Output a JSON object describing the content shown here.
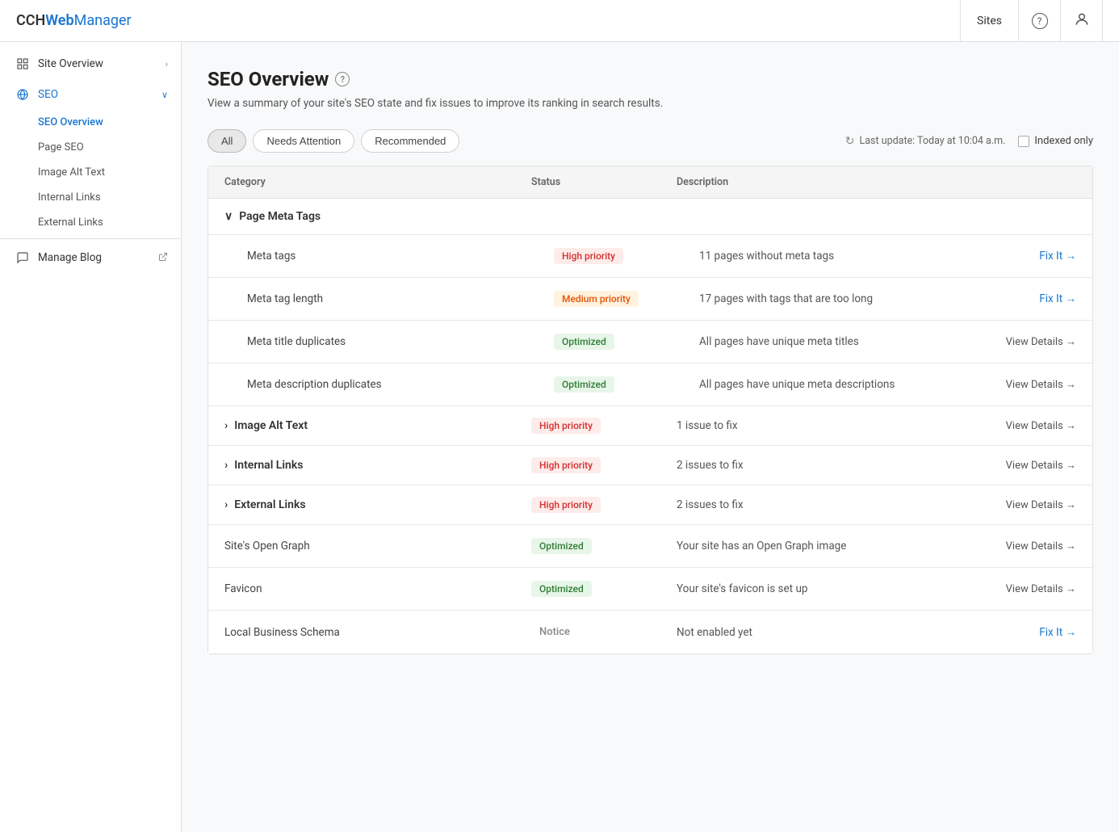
{
  "app": {
    "brand_cch": "CCH",
    "brand_web": " Web",
    "brand_manager": " Manager"
  },
  "topnav": {
    "sites_label": "Sites",
    "help_icon": "?",
    "user_icon": "👤"
  },
  "sidebar": {
    "items": [
      {
        "id": "site-overview",
        "label": "Site Overview",
        "icon": "grid",
        "hasChevron": true
      },
      {
        "id": "seo",
        "label": "SEO",
        "icon": "globe",
        "hasChevron": true,
        "expanded": true
      }
    ],
    "sub_items": [
      {
        "id": "seo-overview",
        "label": "SEO Overview",
        "active": true
      },
      {
        "id": "page-seo",
        "label": "Page SEO",
        "active": false
      },
      {
        "id": "image-alt-text",
        "label": "Image Alt Text",
        "active": false
      },
      {
        "id": "internal-links",
        "label": "Internal Links",
        "active": false
      },
      {
        "id": "external-links",
        "label": "External Links",
        "active": false
      }
    ],
    "manage_blog": {
      "label": "Manage Blog",
      "icon": "chat",
      "external": true
    }
  },
  "page": {
    "title": "SEO Overview",
    "subtitle": "View a summary of your site's SEO state and fix issues to improve its ranking in search results."
  },
  "filters": {
    "all_label": "All",
    "needs_attention_label": "Needs Attention",
    "recommended_label": "Recommended",
    "last_update": "Last update: Today at 10:04 a.m.",
    "indexed_only_label": "Indexed only"
  },
  "table": {
    "headers": [
      "Category",
      "Status",
      "Description"
    ],
    "sections": [
      {
        "id": "page-meta-tags",
        "label": "Page Meta Tags",
        "expanded": true,
        "items": [
          {
            "label": "Meta tags",
            "status_type": "high",
            "status_label": "High priority",
            "description": "11 pages without meta tags",
            "action_type": "fix",
            "action_label": "Fix It →"
          },
          {
            "label": "Meta tag length",
            "status_type": "medium",
            "status_label": "Medium priority",
            "description": "17 pages with tags that are too long",
            "action_type": "fix",
            "action_label": "Fix It →"
          },
          {
            "label": "Meta title duplicates",
            "status_type": "optimized",
            "status_label": "Optimized",
            "description": "All pages have unique meta titles",
            "action_type": "view",
            "action_label": "View Details →"
          },
          {
            "label": "Meta description duplicates",
            "status_type": "optimized",
            "status_label": "Optimized",
            "description": "All pages have unique meta descriptions",
            "action_type": "view",
            "action_label": "View Details →"
          }
        ]
      }
    ],
    "top_level_rows": [
      {
        "id": "image-alt-text",
        "label": "Image Alt Text",
        "collapsed": true,
        "status_type": "high",
        "status_label": "High priority",
        "description": "1 issue to fix",
        "action_type": "view",
        "action_label": "View Details →"
      },
      {
        "id": "internal-links",
        "label": "Internal Links",
        "collapsed": true,
        "status_type": "high",
        "status_label": "High priority",
        "description": "2 issues to fix",
        "action_type": "view",
        "action_label": "View Details →"
      },
      {
        "id": "external-links",
        "label": "External Links",
        "collapsed": true,
        "status_type": "high",
        "status_label": "High priority",
        "description": "2 issues to fix",
        "action_type": "view",
        "action_label": "View Details →"
      },
      {
        "id": "sites-open-graph",
        "label": "Site's Open Graph",
        "status_type": "optimized",
        "status_label": "Optimized",
        "description": "Your site has an Open Graph image",
        "action_type": "view",
        "action_label": "View Details →"
      },
      {
        "id": "favicon",
        "label": "Favicon",
        "status_type": "optimized",
        "status_label": "Optimized",
        "description": "Your site's favicon is set up",
        "action_type": "view",
        "action_label": "View Details →"
      },
      {
        "id": "local-business-schema",
        "label": "Local Business Schema",
        "status_type": "notice",
        "status_label": "Notice",
        "description": "Not enabled yet",
        "action_type": "fix",
        "action_label": "Fix It →"
      }
    ]
  }
}
